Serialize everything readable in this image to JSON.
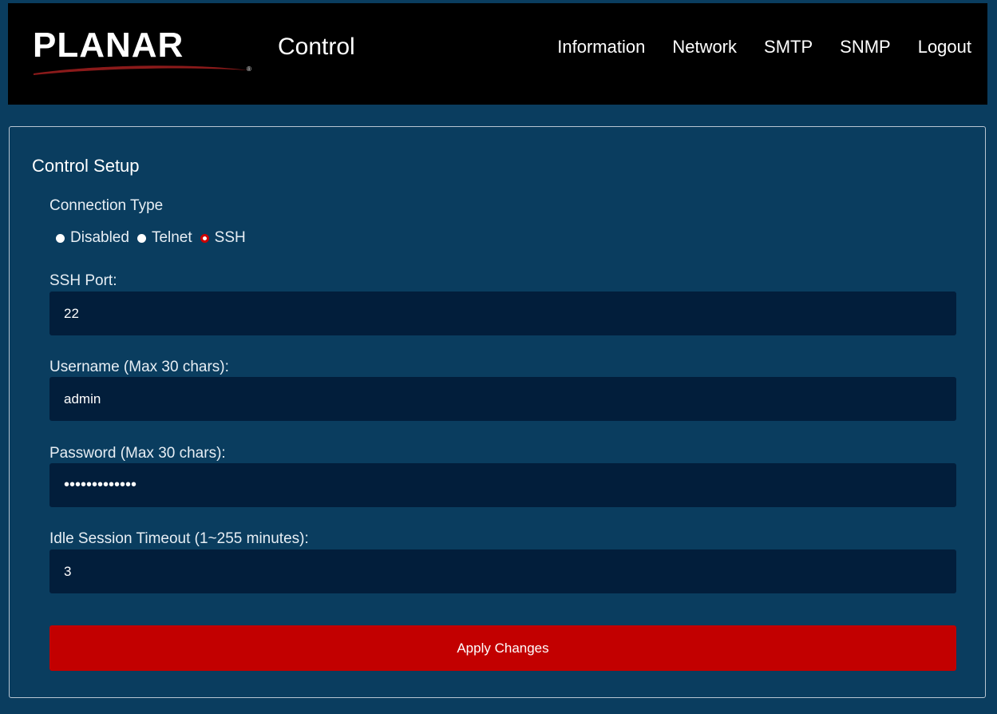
{
  "header": {
    "logo_text": "PLANAR",
    "logo_reg": "®",
    "app_title": "Control",
    "nav": [
      "Information",
      "Network",
      "SMTP",
      "SNMP",
      "Logout"
    ]
  },
  "panel": {
    "title": "Control Setup",
    "connection_type": {
      "label": "Connection Type",
      "options": [
        "Disabled",
        "Telnet",
        "SSH"
      ],
      "selected": "SSH"
    },
    "ssh_port": {
      "label": "SSH Port:",
      "value": "22"
    },
    "username": {
      "label": "Username (Max 30 chars):",
      "value": "admin"
    },
    "password": {
      "label": "Password (Max 30 chars):",
      "value": "•••••••••••••"
    },
    "timeout": {
      "label": "Idle Session Timeout (1~255 minutes):",
      "value": "3"
    },
    "apply_label": "Apply Changes"
  },
  "colors": {
    "background": "#0a3d5f",
    "header": "#000000",
    "input": "#021e3b",
    "accent": "#c20000"
  }
}
